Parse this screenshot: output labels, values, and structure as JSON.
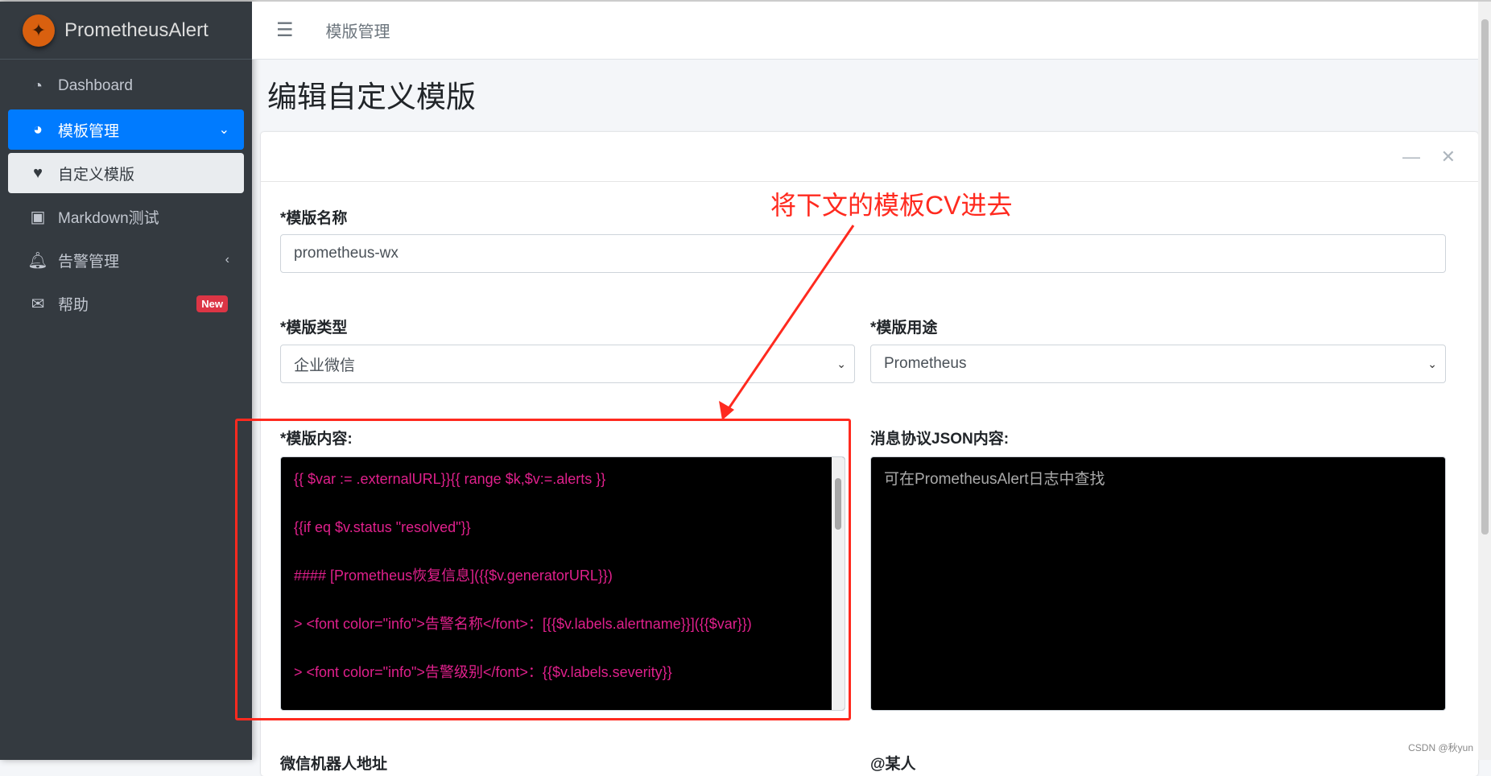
{
  "brand": {
    "name": "PrometheusAlert",
    "logo_icon": "prometheus-logo"
  },
  "sidebar": {
    "items": [
      {
        "label": "Dashboard",
        "icon": "tachometer-icon"
      },
      {
        "label": "模板管理",
        "icon": "pie-chart-icon",
        "state": "expanded"
      },
      {
        "label": "自定义模版",
        "icon": "heart-icon",
        "state": "selected"
      },
      {
        "label": "Markdown测试",
        "icon": "image-icon"
      },
      {
        "label": "告警管理",
        "icon": "bell-icon"
      },
      {
        "label": "帮助",
        "icon": "envelope-icon",
        "badge": "New"
      }
    ]
  },
  "topbar": {
    "breadcrumb": "模版管理"
  },
  "page": {
    "title": "编辑自定义模版"
  },
  "form": {
    "name_label": "*模版名称",
    "name_value": "prometheus-wx",
    "type_label": "*模版类型",
    "type_value": "企业微信",
    "use_label": "*模版用途",
    "use_value": "Prometheus",
    "content_label": "*模版内容:",
    "content_lines": [
      "{{ $var := .externalURL}}{{ range $k,$v:=.alerts }}",
      "{{if eq $v.status \"resolved\"}}",
      "#### [Prometheus恢复信息]({{$v.generatorURL}})",
      "> <font color=\"info\">告警名称</font>：[{{$v.labels.alertname}}]({{$var}})",
      "> <font color=\"info\">告警级别</font>：{{$v.labels.severity}}"
    ],
    "json_label": "消息协议JSON内容:",
    "json_placeholder": "可在PrometheusAlert日志中查找",
    "robot_label": "微信机器人地址",
    "at_label": "@某人"
  },
  "annotation": {
    "text": "将下文的模板CV进去",
    "color": "#ff2a1f"
  },
  "watermark": "CSDN @秋yun",
  "colors": {
    "accent": "#007bff",
    "template_text": "#e0208c",
    "sidebar": "#343a40"
  }
}
